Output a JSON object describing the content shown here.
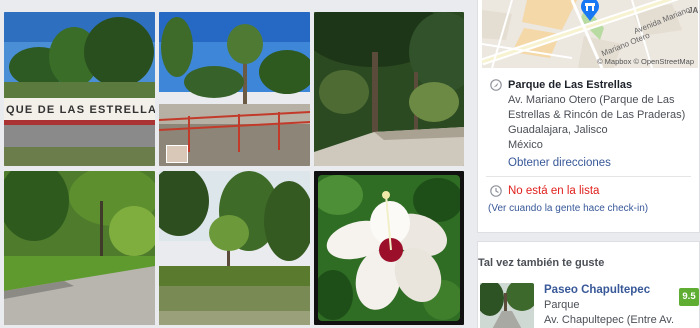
{
  "photos": {
    "sign_text": "QUE DE LAS ESTRELLAS"
  },
  "place": {
    "name": "Parque de Las Estrellas",
    "address_lines": [
      "Av. Mariano Otero (Parque de Las",
      "Estrellas & Rincón de Las Praderas)",
      "Guadalajara, Jalisco",
      "México"
    ],
    "directions_link": "Obtener direcciones",
    "status": "No está en la lista",
    "checkin_link": "(Ver cuando la gente hace check-in)"
  },
  "map": {
    "street_label": "Mariano Otero",
    "avenue_label": "Avenida Mariano",
    "corner_label": "JA",
    "credit": "© Mapbox © OpenStreetMap",
    "marker_color": "#1877f2"
  },
  "suggestions": {
    "title": "Tal vez también te guste",
    "items": [
      {
        "name": "Paseo Chapultepec",
        "category": "Parque",
        "address": "Av. Chapultepec (Entre Av.",
        "score": "9.5",
        "score_color": "#5fae33"
      }
    ]
  },
  "icons": {
    "location": "location-pin-icon",
    "clock": "clock-icon",
    "map_marker": "map-marker-icon"
  }
}
